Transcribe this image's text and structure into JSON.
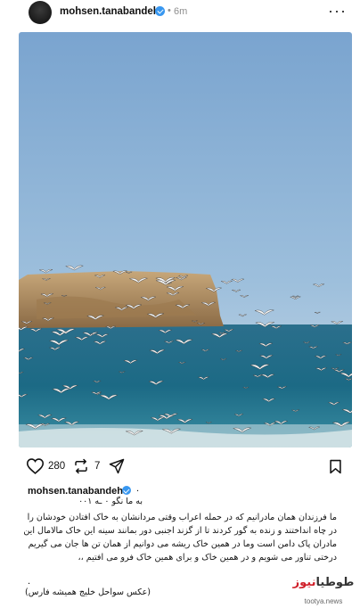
{
  "header": {
    "username": "mohsen.tanabandeh",
    "separator": "•",
    "time": "6m",
    "more": "···"
  },
  "post": {
    "image_alt": "",
    "likes": "280",
    "reposts": "7"
  },
  "caption": {
    "username": "mohsen.tanabandeh",
    "dot": ".",
    "line1": "به ما نگو ۰ ـه ۰۰۱",
    "body": "ما فرزندان همان مادرانیم که در حمله اعراب وقتی مردانشان به خاک افتادن خودشان را در چاه انداختند و زنده به گور کردند تا از گزند اجنبی دور بمانند سینه این خاک مالامال این مادران پاک دامن است وما در همین خاک ریشه می دوانیم از همان تن ها جان می گیریم درختی تناور می شویم و در همین خاک و برای همین خاک فرو می افتیم ،،",
    "dot2": ".",
    "last": "(عکس سواحل خلیج همیشه فارس)"
  },
  "watermark": {
    "logo_black": "طوطیا",
    "logo_red": "نیوز",
    "url": "tootya.news"
  },
  "icons": {
    "like": "heart-icon",
    "repost": "repost-icon",
    "share": "send-icon",
    "save": "bookmark-icon",
    "verified": "verified-badge-icon",
    "more": "more-icon"
  },
  "colors": {
    "verified": "#3897f0",
    "sky": "#8fb3d6",
    "sea": "#1f6f8f",
    "watermark_red": "#d0202a"
  }
}
